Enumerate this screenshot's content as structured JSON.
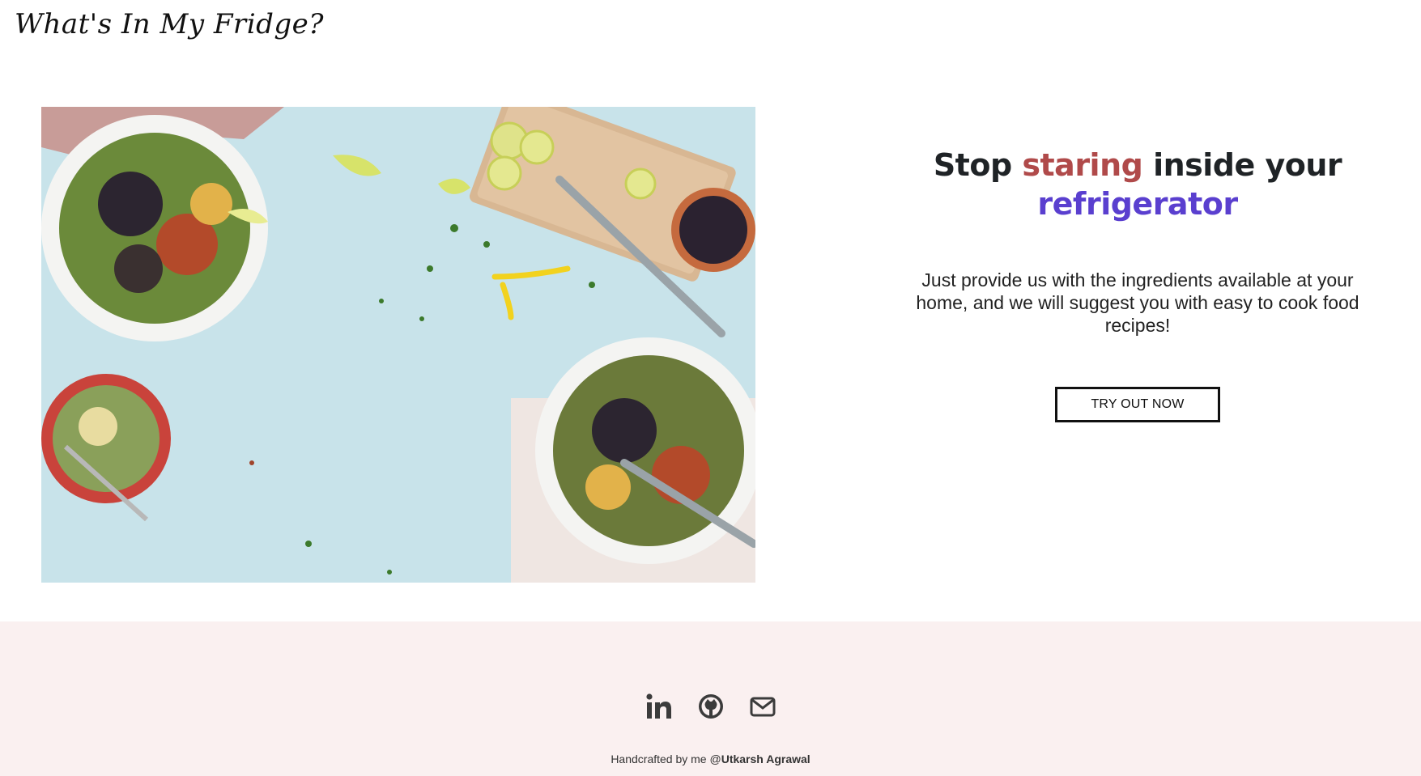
{
  "brand": {
    "title": "What's In My Fridge?"
  },
  "hero": {
    "headline_part1": "Stop ",
    "headline_highlight1": "staring",
    "headline_part2": " inside your ",
    "headline_highlight2": "refrigerator",
    "subtext": "Just provide us with the ingredients available at your home, and we will suggest you with easy to cook food recipes!",
    "cta_label": "TRY OUT NOW",
    "colors": {
      "staring": "#b04a4a",
      "refrigerator": "#5a3fcf"
    }
  },
  "footer": {
    "social": [
      {
        "name": "linkedin-icon"
      },
      {
        "name": "github-icon"
      },
      {
        "name": "mail-icon"
      }
    ],
    "credit_prefix": "Handcrafted by me @",
    "credit_name": "Utkarsh Agrawal",
    "background": "#faf0f0"
  }
}
